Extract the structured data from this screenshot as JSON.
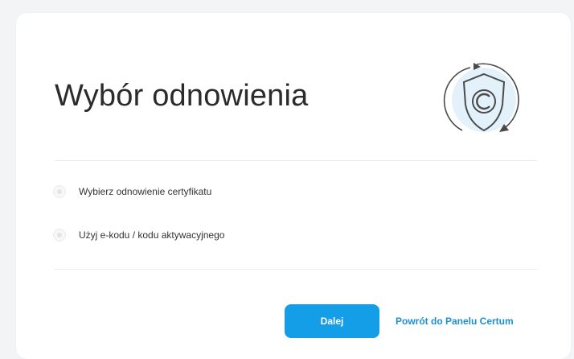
{
  "page": {
    "title": "Wybór odnowienia"
  },
  "options": [
    {
      "label": "Wybierz odnowienie certyfikatu",
      "selected": false
    },
    {
      "label": "Użyj e-kodu / kodu aktywacyjnego",
      "selected": false
    }
  ],
  "actions": {
    "next_label": "Dalej",
    "back_label": "Powrót do Panelu Certum"
  },
  "icons": {
    "logo": "renewal-shield-icon"
  },
  "colors": {
    "accent": "#159ee8",
    "link": "#1a8fd6",
    "title": "#2b2b2b",
    "logo_fill": "#e3f1fb",
    "logo_stroke": "#4a4a4a"
  }
}
